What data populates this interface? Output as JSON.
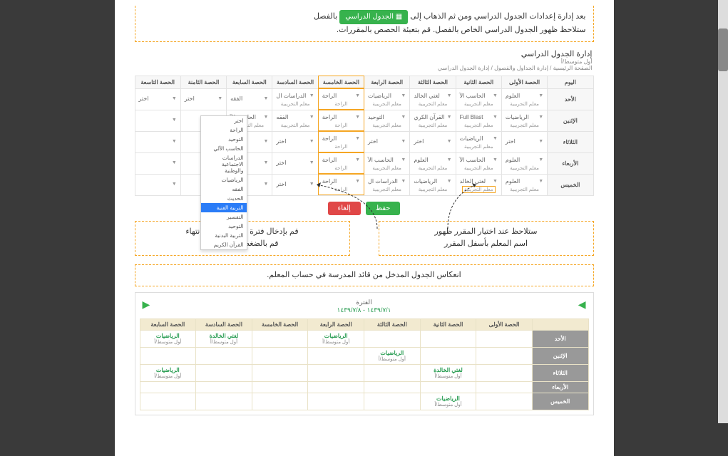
{
  "intro": {
    "line1_pre": "بعد إدارة إعدادات الجدول الدراسي ومن ثم الذهاب إلى ",
    "badge": "الجدول الدراسي",
    "line1_post": " بالفصل",
    "line2": "ستلاحظ ظهور الجدول الدراسي الخاص بالفصل. قم بتعبئة الحصص بالمقررات."
  },
  "breadcrumb": {
    "title": "إدارة الجدول الدراسي",
    "sub1": "أول متوسط/أ",
    "sub2": "الصفحة الرئيسية  /  إدارة الجداول والفصول  /  إدارة الجدول الدراسي"
  },
  "headers": [
    "اليوم",
    "الحصة الأولى",
    "الحصة الثانية",
    "الحصة الثالثة",
    "الحصة الرابعة",
    "الحصة الخامسة",
    "الحصة السادسة",
    "الحصة السابعة",
    "الحصة الثامنة",
    "الحصة التاسعة"
  ],
  "days": [
    "الأحد",
    "الإثنين",
    "الثلاثاء",
    "الأربعاء",
    "الخميس"
  ],
  "rows": [
    [
      {
        "s": "العلوم",
        "t": "معلم التجريبية"
      },
      {
        "s": "الحاسب الآ",
        "t": "معلم التجريبية"
      },
      {
        "s": "لغتي الخالد",
        "t": "معلم التجريبية"
      },
      {
        "s": "الرياضيات",
        "t": "معلم التجريبية"
      },
      {
        "s": "الراحة",
        "t": "الراحة"
      },
      {
        "s": "الدراسات ال",
        "t": "معلم التجريبية"
      },
      {
        "s": "الفقه",
        "t": ""
      },
      {
        "s": "اختر",
        "t": ""
      },
      {
        "s": "اختر",
        "t": ""
      }
    ],
    [
      {
        "s": "الرياضيات",
        "t": "معلم التجريبية"
      },
      {
        "s": "Full Blast",
        "t": "معلم التجريبية"
      },
      {
        "s": "القرآن الكري",
        "t": "معلم التجريبية"
      },
      {
        "s": "التوحيد",
        "t": "معلم التجريبية"
      },
      {
        "s": "الراحة",
        "t": "الراحة"
      },
      {
        "s": "الفقه",
        "t": "معلم التجريبية"
      },
      {
        "s": "الحاسب الآ",
        "t": "معلم التجريبية"
      },
      {
        "s": "",
        "t": ""
      },
      {
        "s": "",
        "t": ""
      }
    ],
    [
      {
        "s": "اختر",
        "t": ""
      },
      {
        "s": "الرياضيات",
        "t": "معلم التجريبية"
      },
      {
        "s": "اختر",
        "t": ""
      },
      {
        "s": "اختر",
        "t": ""
      },
      {
        "s": "الراحة",
        "t": "الراحة"
      },
      {
        "s": "اختر",
        "t": ""
      },
      {
        "s": "اختر",
        "t": ""
      },
      {
        "s": "",
        "t": ""
      },
      {
        "s": "",
        "t": ""
      }
    ],
    [
      {
        "s": "العلوم",
        "t": "معلم التجريبية"
      },
      {
        "s": "الحاسب الآ",
        "t": "معلم التجريبية"
      },
      {
        "s": "العلوم",
        "t": "معلم التجريبية"
      },
      {
        "s": "الحاسب الآ",
        "t": "معلم التجريبية"
      },
      {
        "s": "الراحة",
        "t": "الراحة"
      },
      {
        "s": "اختر",
        "t": ""
      },
      {
        "s": "اختر",
        "t": ""
      },
      {
        "s": "",
        "t": ""
      },
      {
        "s": "",
        "t": ""
      }
    ],
    [
      {
        "s": "العلوم",
        "t": "معلم التجريبية"
      },
      {
        "s": "لغتي الخالد",
        "t": "معلم التجريبية",
        "hl": true
      },
      {
        "s": "الرياضيات",
        "t": "معلم التجريبية"
      },
      {
        "s": "الدراسات ال",
        "t": "معلم التجريبية"
      },
      {
        "s": "الراحة",
        "t": "الراحة"
      },
      {
        "s": "اختر",
        "t": ""
      },
      {
        "s": "اختر",
        "t": ""
      },
      {
        "s": "",
        "t": ""
      },
      {
        "s": "",
        "t": ""
      }
    ]
  ],
  "dropdown_items": [
    "اختر",
    "الراحة",
    "التوحيد",
    "الحاسب الآلي",
    "الدراسات الاجتماعية والوطنية",
    "الرياضيات",
    "الفقه",
    "الحديث",
    "التربية الفنية",
    "التفسير",
    "التوحيد",
    "التربية البدنية",
    "القرآن الكريم"
  ],
  "dropdown_selected_index": 8,
  "buttons": {
    "save": "حفظ",
    "cancel": "إلغاء"
  },
  "callouts": {
    "right": "قم بإدخال فترة الراحة، وبعد الانتهاء",
    "right2_a": "قم بالضغط على ",
    "right2_b": "حفظ.",
    "left1": "ستلاحظ عند اختيار المقرر ظهور",
    "left2": "اسم المعلم بأسفل المقرر",
    "reflect": "انعكاس الجدول المدخل من قائد المدرسة في حساب المعلم."
  },
  "period": {
    "label": "الفترة",
    "range": "١٤٣٩/٧/١ - ١٤٣٩/٧/٨"
  },
  "theaders": [
    "",
    "الحصة الأولى",
    "الحصة الثانية",
    "الحصة الثالثة",
    "الحصة الرابعة",
    "الحصة الخامسة",
    "الحصة السادسة",
    "الحصة السابعة"
  ],
  "tdays": [
    "الأحد",
    "الإثنين",
    "الثلاثاء",
    "الأربعاء",
    "الخميس"
  ],
  "trows": [
    [
      null,
      null,
      null,
      {
        "s": "الرياضيات",
        "c": "أول متوسط/أ"
      },
      null,
      {
        "s": "لغتي الخالدة",
        "c": "أول متوسط/أ"
      },
      {
        "s": "الرياضيات",
        "c": "أول متوسط/أ"
      }
    ],
    [
      null,
      null,
      {
        "s": "الرياضيات",
        "c": "أول متوسط/أ"
      },
      null,
      null,
      null,
      null
    ],
    [
      null,
      {
        "s": "لغتي الخالدة",
        "c": "أول متوسط/أ"
      },
      null,
      null,
      null,
      null,
      {
        "s": "الرياضيات",
        "c": "أول متوسط/أ"
      }
    ],
    [
      null,
      null,
      null,
      null,
      null,
      null,
      null
    ],
    [
      null,
      {
        "s": "الرياضيات",
        "c": "أول متوسط/أ"
      },
      null,
      null,
      null,
      null,
      null
    ]
  ]
}
